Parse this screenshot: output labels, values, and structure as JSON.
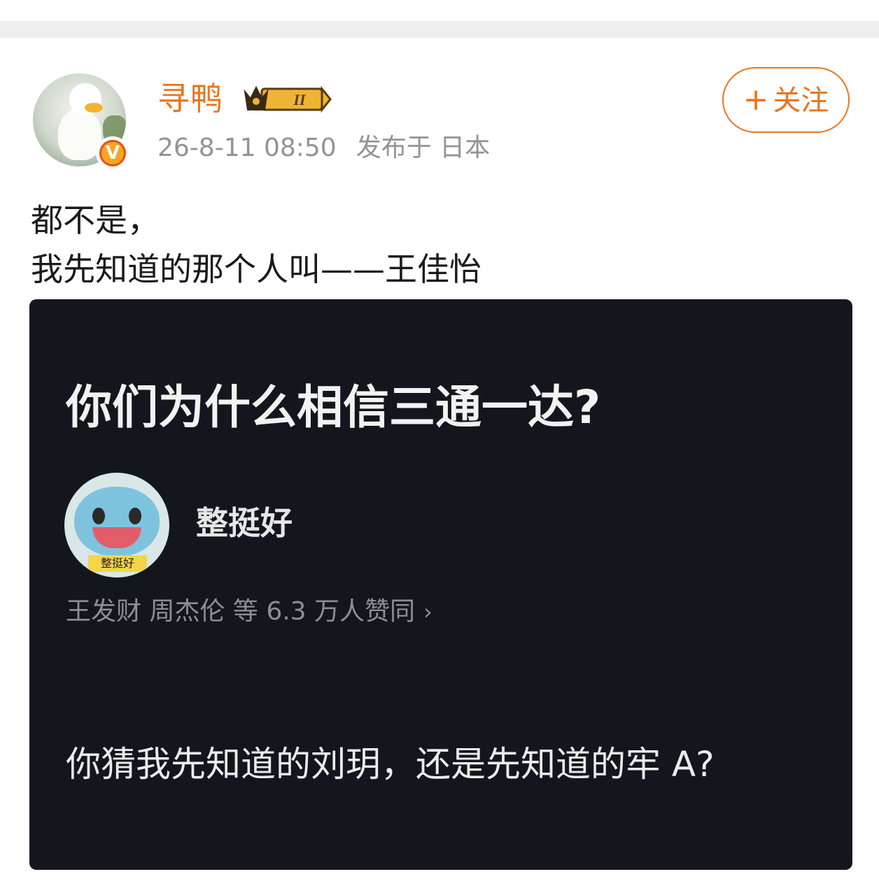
{
  "post": {
    "author": {
      "name": "寻鸭",
      "level": "II",
      "verified_mark": "V",
      "avatar_icon": "duck-avatar"
    },
    "meta": {
      "time": "26-8-11 08:50",
      "location": "发布于 日本"
    },
    "follow_button": {
      "plus": "+",
      "label": "关注"
    },
    "text": {
      "line1": "都不是，",
      "line2": "我先知道的那个人叫——王佳怡"
    }
  },
  "embedded_card": {
    "question": "你们为什么相信三通一达?",
    "answer_author": {
      "name": "整挺好",
      "avatar_caption": "整挺好"
    },
    "likes_text": "王发财 周杰伦 等 6.3 万人赞同",
    "likes_arrow": "›",
    "answer_text": "你猜我先知道的刘玥，还是先知道的牢 A?"
  },
  "colors": {
    "accent": "#e7751f",
    "card_bg": "#14161d",
    "meta_gray": "#939393"
  }
}
